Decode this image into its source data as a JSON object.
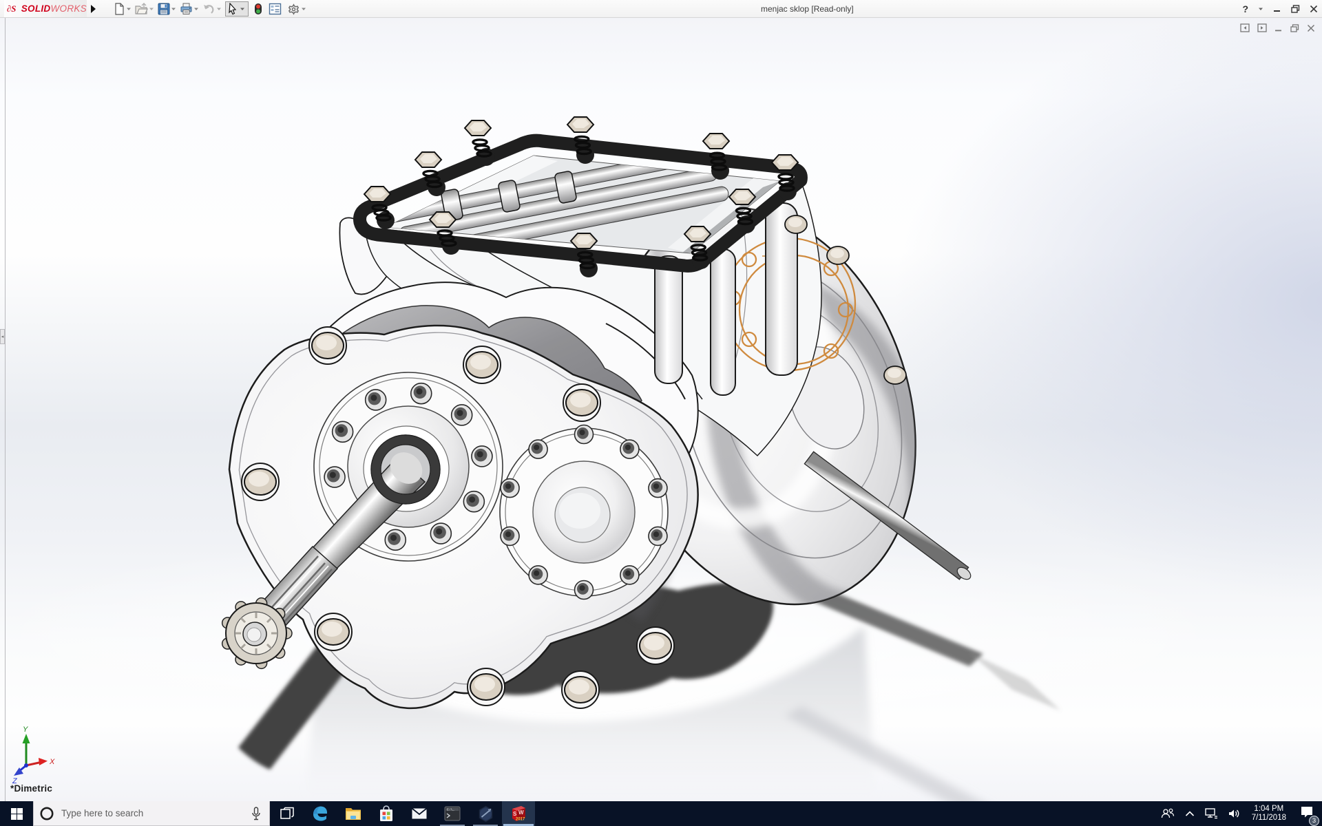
{
  "window": {
    "title": "menjac sklop [Read-only]",
    "help_label": "?",
    "controls": [
      "minimize",
      "restore",
      "close"
    ]
  },
  "brand": {
    "name_bold": "SOLID",
    "name_light": "WORKS",
    "logo": "ds-swirl",
    "logo_glyph": "∂S"
  },
  "toolbar": {
    "icons": [
      "new-document",
      "open",
      "save",
      "print",
      "undo",
      "select-arrow",
      "display-colors",
      "report",
      "options"
    ]
  },
  "viewport": {
    "orientation_label": "*Dimetric",
    "triad": {
      "x": "X",
      "y": "Y",
      "z": "Z"
    },
    "selection_color": "#cf8a3e",
    "child_window_controls": [
      "dock-left",
      "dock-right",
      "minimize",
      "restore",
      "close"
    ]
  },
  "model": {
    "name": "gearbox assembly",
    "style": "shaded-with-edges"
  },
  "taskbar": {
    "start": "start-button",
    "search_placeholder": "Type here to search",
    "apps": [
      "task-view",
      "edge",
      "file-explorer",
      "store",
      "mail",
      "command-prompt",
      "solidworks-rx",
      "solidworks-2017"
    ],
    "sw_icon": {
      "s": "S",
      "w": "W",
      "year": "2017"
    },
    "tray": {
      "icons": [
        "people",
        "chevron-up",
        "network",
        "volume"
      ],
      "time": "1:04 PM",
      "date": "7/11/2018",
      "notification_count": "3"
    }
  }
}
